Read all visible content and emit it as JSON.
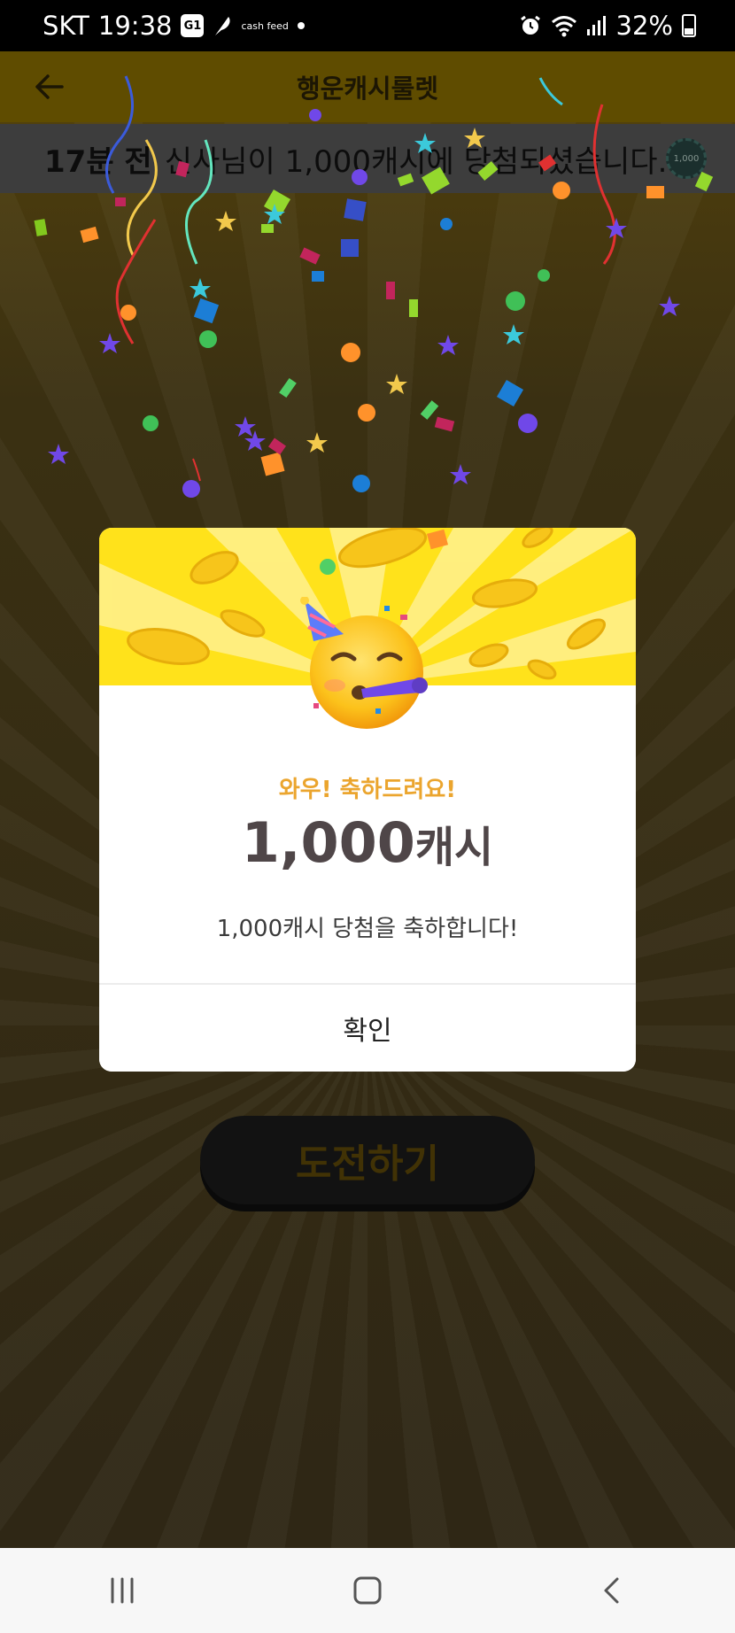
{
  "status_bar": {
    "carrier": "SKT",
    "time": "19:38",
    "notification_badge": "G1",
    "notification_app": "cash feed",
    "battery": "32%"
  },
  "header": {
    "title": "행운캐시룰렛"
  },
  "ticker": {
    "time_ago": "17분 전",
    "message": "신사님이 1,000캐시에 당첨되셨습니다.",
    "coin_label": "1,000"
  },
  "modal": {
    "subtitle": "와우! 축하드려요!",
    "amount": "1,000",
    "amount_unit": "캐시",
    "message": "1,000캐시 당첨을 축하합니다!",
    "confirm_label": "확인"
  },
  "challenge_button": {
    "label": "도전하기"
  },
  "colors": {
    "banner_yellow": "#ffe21b",
    "subtitle_orange": "#eba52e",
    "amount_text": "#4f4648",
    "dim_background": "#2f2715"
  },
  "icons": {
    "back": "arrow-left-icon",
    "emoji": "partying-face-icon",
    "nav_recents": "recents-icon",
    "nav_home": "home-icon",
    "nav_back": "chevron-left-icon"
  }
}
